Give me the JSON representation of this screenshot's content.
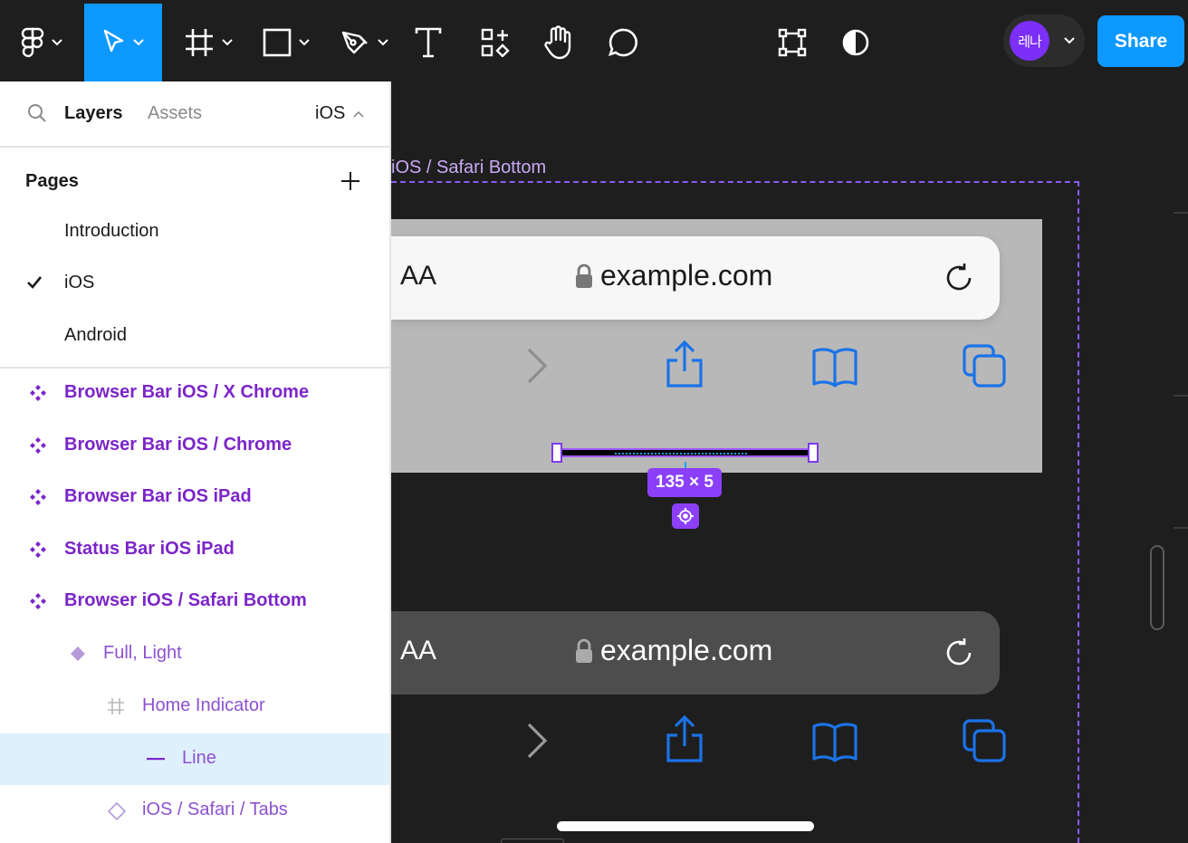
{
  "colors": {
    "accent": "#0d99ff",
    "component_purple": "#7b25c9",
    "selection": "#8b3ff8",
    "toolbar_bg": "#1e1e1e"
  },
  "toolbar": {
    "tools": [
      {
        "icon": "figma-menu-icon"
      },
      {
        "icon": "move-icon",
        "active": true
      },
      {
        "icon": "frame-icon"
      },
      {
        "icon": "rectangle-icon"
      },
      {
        "icon": "pen-icon"
      },
      {
        "icon": "text-icon"
      },
      {
        "icon": "resources-icon"
      },
      {
        "icon": "hand-icon"
      },
      {
        "icon": "comment-icon"
      },
      {
        "icon": "transform-icon"
      },
      {
        "icon": "contrast-icon"
      }
    ],
    "avatar_initials": "레나",
    "share_label": "Share"
  },
  "sidebar": {
    "tab_layers": "Layers",
    "tab_assets": "Assets",
    "current_page": "iOS",
    "pages_title": "Pages",
    "pages": [
      {
        "label": "Introduction",
        "selected": false
      },
      {
        "label": "iOS",
        "selected": true
      },
      {
        "label": "Android",
        "selected": false
      }
    ],
    "layers": [
      {
        "label": "Browser Bar iOS / X Chrome",
        "type": "component",
        "icon": "component-icon"
      },
      {
        "label": "Browser Bar iOS / Chrome",
        "type": "component",
        "icon": "component-icon"
      },
      {
        "label": "Browser Bar iOS iPad",
        "type": "component",
        "icon": "component-icon"
      },
      {
        "label": "Status Bar iOS iPad",
        "type": "component",
        "icon": "component-icon"
      },
      {
        "label": "Browser iOS / Safari Bottom",
        "type": "component",
        "icon": "component-icon"
      },
      {
        "label": "Full, Light",
        "type": "variant",
        "icon": "variant-diamond-icon"
      },
      {
        "label": "Home Indicator",
        "type": "frame",
        "icon": "frame-hash-icon"
      },
      {
        "label": "Line",
        "type": "line",
        "icon": "line-icon",
        "selected": true
      },
      {
        "label": "iOS / Safari / Tabs",
        "type": "instance",
        "icon": "instance-diamond-icon"
      }
    ]
  },
  "canvas": {
    "frame_label": "iOS / Safari Bottom",
    "light_bar": {
      "aa": "AA",
      "url": "example.com"
    },
    "dark_bar": {
      "aa": "AA",
      "url": "example.com"
    },
    "selection_size": "135 × 5"
  }
}
